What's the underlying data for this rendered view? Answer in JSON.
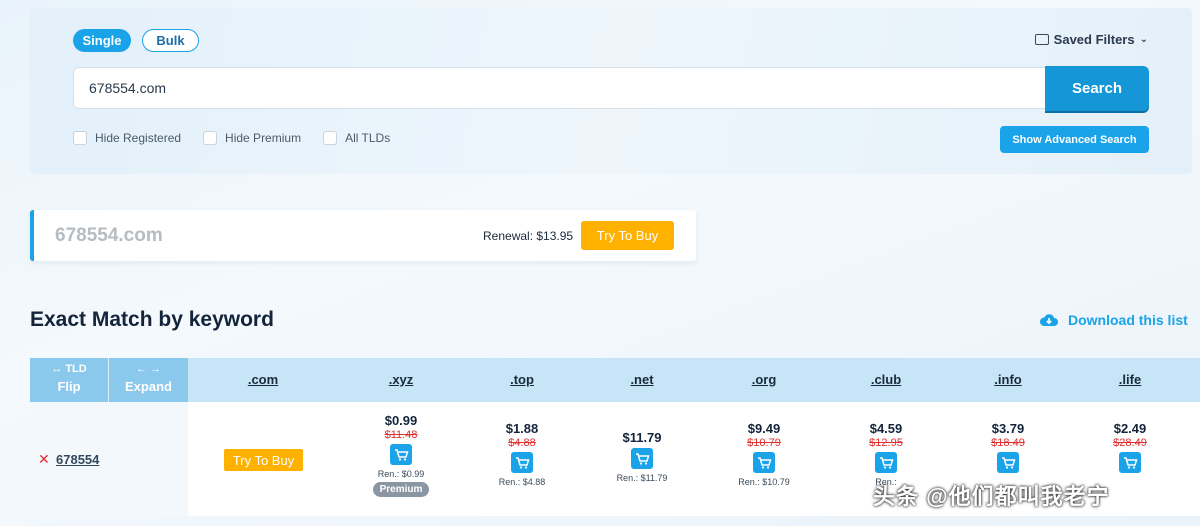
{
  "search": {
    "mode_single": "Single",
    "mode_bulk": "Bulk",
    "saved_filters": "Saved Filters",
    "query": "678554.com",
    "search_label": "Search",
    "filters": [
      "Hide Registered",
      "Hide Premium",
      "All TLDs"
    ],
    "advanced_label": "Show Advanced Search"
  },
  "result": {
    "name_base": "678554",
    "name_tld": ".com",
    "renewal": "Renewal: $13.95",
    "buy_label": "Try To Buy"
  },
  "section": {
    "title": "Exact Match by keyword",
    "download_label": "Download this list"
  },
  "table": {
    "flip_small": "↔ TLD",
    "flip_label": "Flip",
    "expand_small": "← →",
    "expand_label": "Expand",
    "tlds": [
      ".com",
      ".xyz",
      ".top",
      ".net",
      ".org",
      ".club",
      ".info",
      ".life"
    ],
    "row_name": "678554",
    "row_buy_label": "Try To Buy",
    "cells": [
      {
        "price": "$0.99",
        "old": "$11.48",
        "ren": "Ren.: $0.99",
        "badge": "Premium"
      },
      {
        "price": "$1.88",
        "old": "$4.88",
        "ren": "Ren.: $4.88"
      },
      {
        "price": "$11.79",
        "old": "",
        "ren": "Ren.: $11.79"
      },
      {
        "price": "$9.49",
        "old": "$10.79",
        "ren": "Ren.: $10.79"
      },
      {
        "price": "$4.59",
        "old": "$12.95",
        "ren": "Ren.:"
      },
      {
        "price": "$3.79",
        "old": "$18.49",
        "ren": ""
      },
      {
        "price": "$2.49",
        "old": "$28.49",
        "ren": ""
      }
    ]
  },
  "watermark": "头条 @他们都叫我老宁",
  "colors": {
    "accent": "#1aa3e8",
    "buy": "#ffb100",
    "strike": "#e03131"
  }
}
